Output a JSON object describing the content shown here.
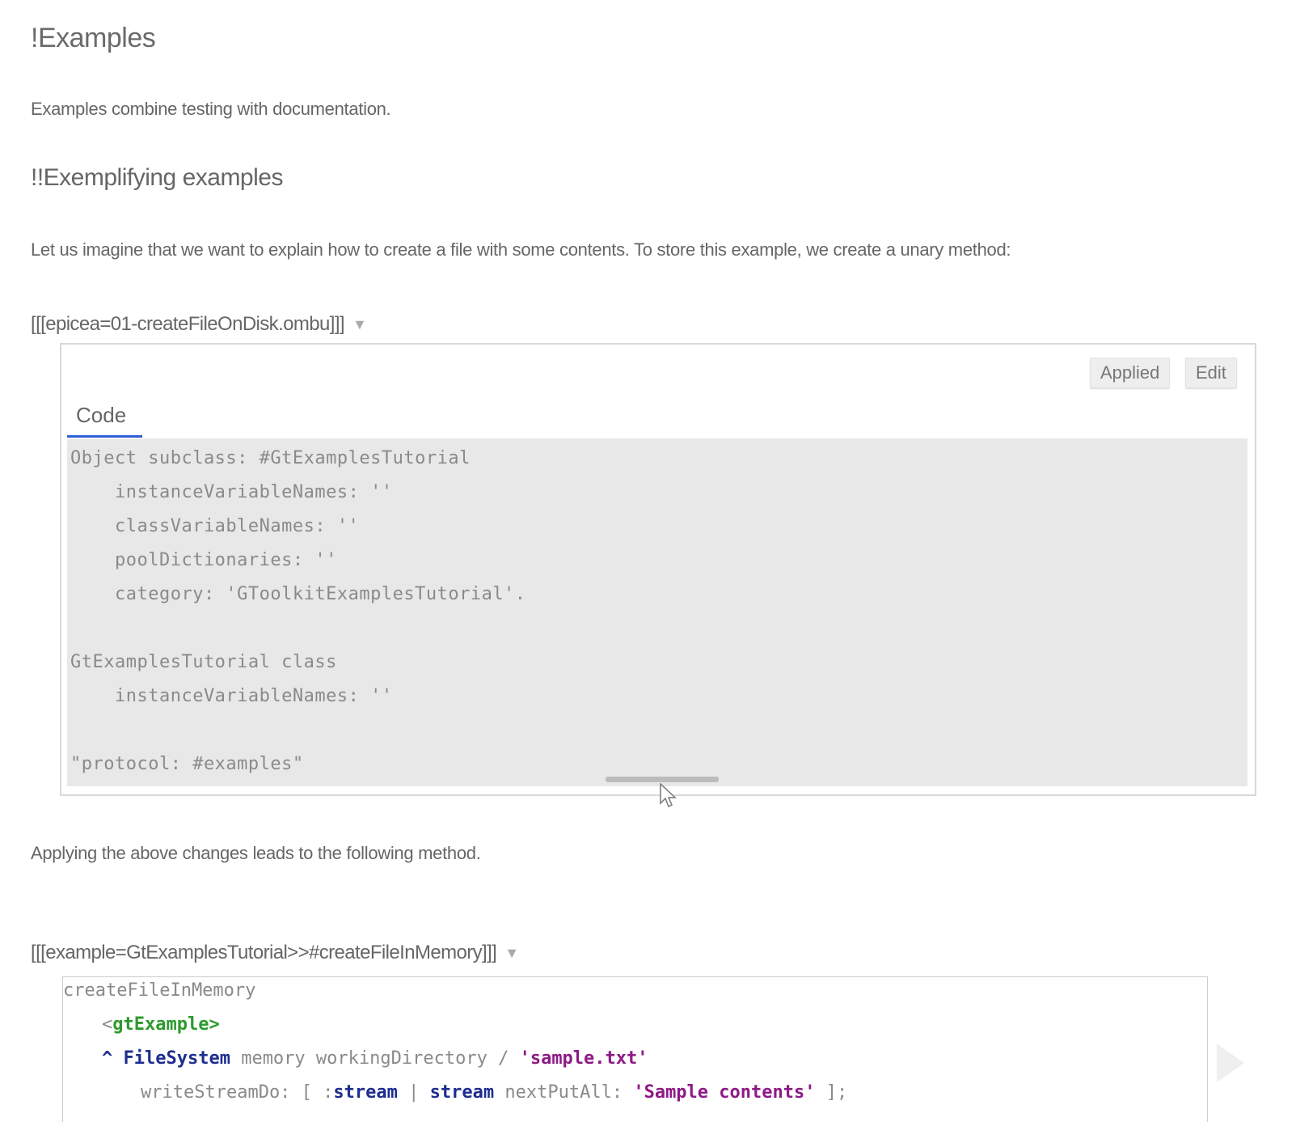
{
  "headings": {
    "h1": "!Examples",
    "h2": "!!Exemplifying examples"
  },
  "paragraphs": {
    "intro": "Examples combine testing with documentation.",
    "imagine": "Let us imagine that we want to explain how to create a file with some contents. To store this example, we create a unary method:",
    "applying": "Applying the above changes leads to the following method."
  },
  "annotations": {
    "epicea": "[[[epicea=01-createFileOnDisk.ombu]]]",
    "example": "[[[example=GtExamplesTutorial>>#createFileInMemory]]]",
    "expand_glyph": "▼"
  },
  "change_panel": {
    "buttons": {
      "applied": "Applied",
      "edit": "Edit"
    },
    "tab": "Code",
    "code_lines": [
      "Object subclass: #GtExamplesTutorial",
      "    instanceVariableNames: ''",
      "    classVariableNames: ''",
      "    poolDictionaries: ''",
      "    category: 'GToolkitExamplesTutorial'.",
      "",
      "GtExamplesTutorial class",
      "    instanceVariableNames: ''",
      "",
      "\"protocol: #examples\""
    ]
  },
  "example_panel": {
    "method_name": "createFileInMemory",
    "pragma_open": "<",
    "pragma": "gtExample>",
    "line2": {
      "caret": "^ ",
      "class": "FileSystem",
      "msg": " memory workingDirectory / ",
      "string": "'sample.txt'"
    },
    "line3": {
      "msg": "writeStreamDo: [ :",
      "arg": "stream",
      "bar": " | ",
      "var": "stream",
      "msg2": " nextPutAll: ",
      "string": "'Sample contents'",
      "close": " ];"
    }
  },
  "icons": {
    "cursor": "mouse-pointer-icon",
    "play": "play-arrow-icon"
  }
}
